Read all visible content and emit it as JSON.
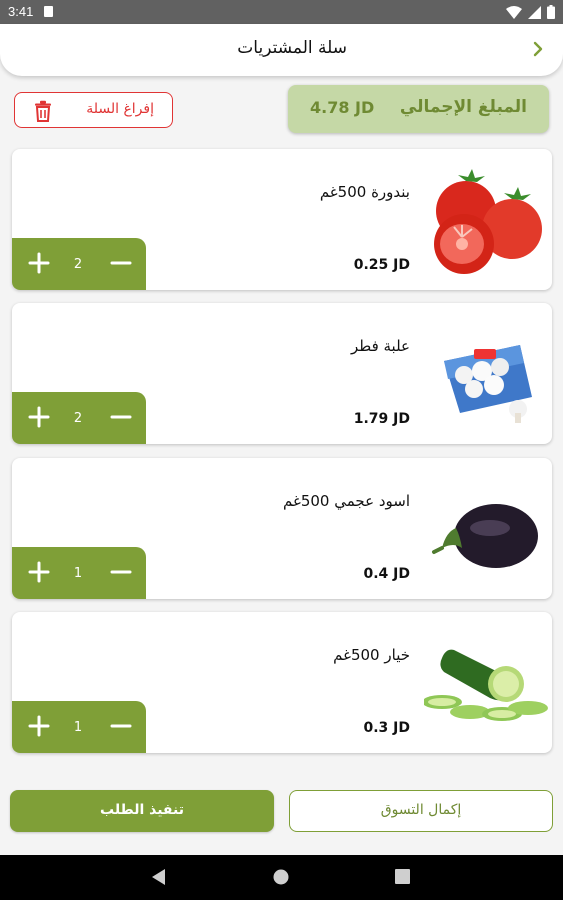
{
  "status_bar": {
    "time": "3:41"
  },
  "header": {
    "title": "سلة المشتريات",
    "back_icon": "chevron-right-icon"
  },
  "summary": {
    "total_label": "المبلغ الإجمالي",
    "total_amount": "4.78 JD",
    "empty_cart_label": "إفراغ السلة"
  },
  "colors": {
    "brand_green": "#7f9f37",
    "light_green": "#c5d8a6",
    "danger_red": "#e03535"
  },
  "items": [
    {
      "name": "بندورة 500غم",
      "price": "0.25 JD",
      "qty": "2",
      "image": "tomato"
    },
    {
      "name": "علبة فطر",
      "price": "1.79 JD",
      "qty": "2",
      "image": "mushroom-box"
    },
    {
      "name": "اسود عجمي 500غم",
      "price": "0.4 JD",
      "qty": "1",
      "image": "eggplant"
    },
    {
      "name": "خيار 500غم",
      "price": "0.3 JD",
      "qty": "1",
      "image": "cucumber"
    }
  ],
  "actions": {
    "submit_label": "تنفيذ الطلب",
    "continue_label": "إكمال التسوق"
  }
}
